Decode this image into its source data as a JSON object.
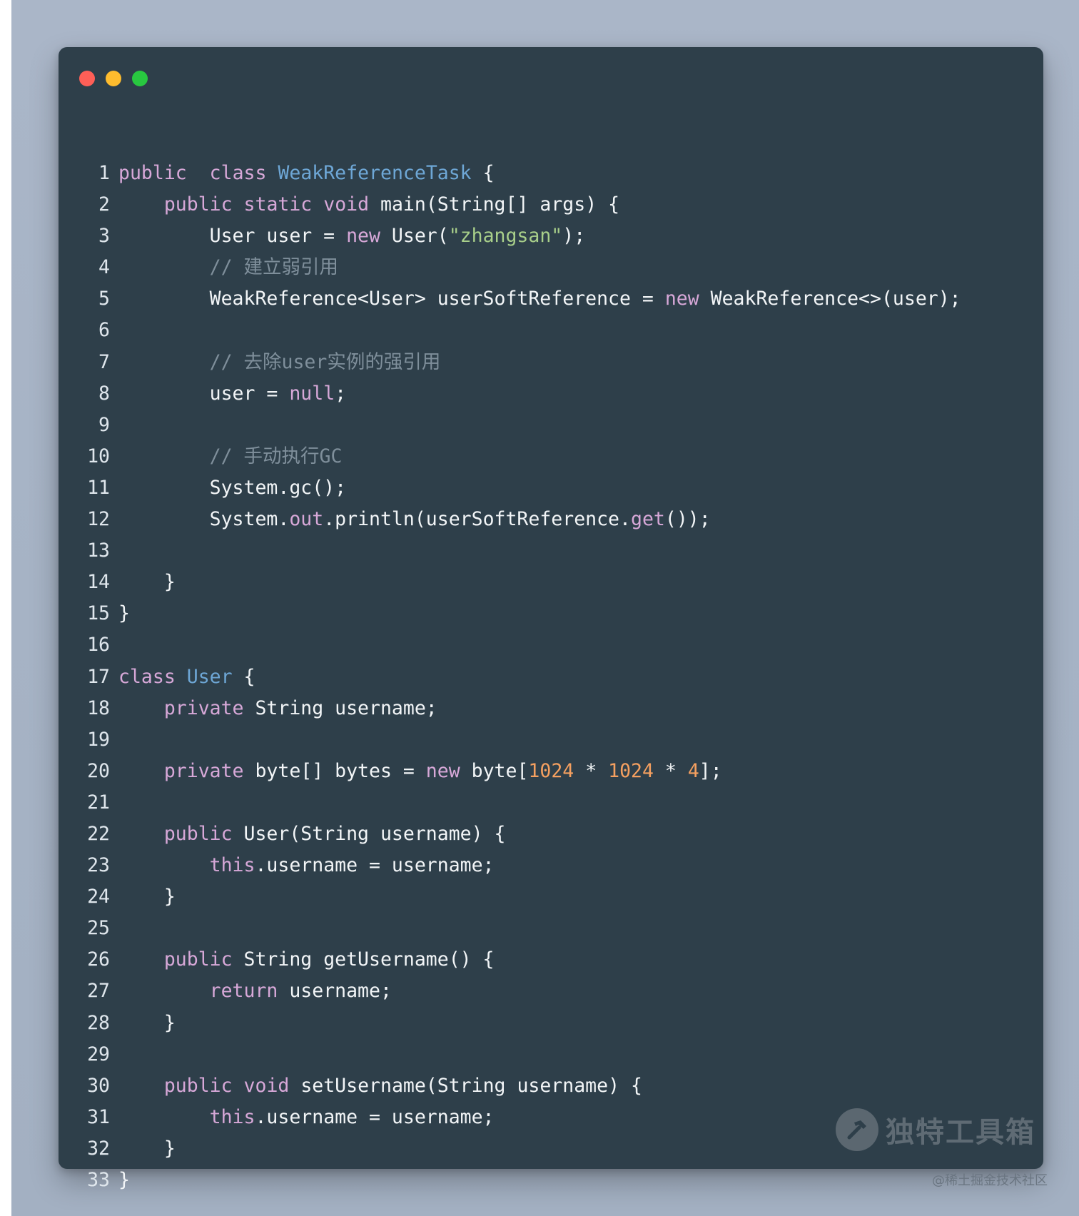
{
  "window_controls": {
    "close": "close",
    "minimize": "minimize",
    "maximize": "maximize"
  },
  "code_lines": [
    {
      "n": "1",
      "tokens": [
        [
          "kw",
          "public"
        ],
        [
          "",
          "  "
        ],
        [
          "kw",
          "class"
        ],
        [
          "",
          " "
        ],
        [
          "cls",
          "WeakReferenceTask"
        ],
        [
          "",
          " {"
        ]
      ]
    },
    {
      "n": "2",
      "tokens": [
        [
          "",
          "    "
        ],
        [
          "kw",
          "public"
        ],
        [
          "",
          " "
        ],
        [
          "kw",
          "static"
        ],
        [
          "",
          " "
        ],
        [
          "kw",
          "void"
        ],
        [
          "",
          " main(String[] args) {"
        ]
      ]
    },
    {
      "n": "3",
      "tokens": [
        [
          "",
          "        User user = "
        ],
        [
          "kw",
          "new"
        ],
        [
          "",
          " User("
        ],
        [
          "str",
          "\"zhangsan\""
        ],
        [
          "",
          ");"
        ]
      ]
    },
    {
      "n": "4",
      "tokens": [
        [
          "",
          "        "
        ],
        [
          "cmt",
          "// 建立弱引用"
        ]
      ]
    },
    {
      "n": "5",
      "tokens": [
        [
          "",
          "        WeakReference<User> userSoftReference = "
        ],
        [
          "kw",
          "new"
        ],
        [
          "",
          " WeakReference<>(user);"
        ]
      ]
    },
    {
      "n": "6",
      "tokens": []
    },
    {
      "n": "7",
      "tokens": [
        [
          "",
          "        "
        ],
        [
          "cmt",
          "// 去除user实例的强引用"
        ]
      ]
    },
    {
      "n": "8",
      "tokens": [
        [
          "",
          "        user = "
        ],
        [
          "kw",
          "null"
        ],
        [
          "",
          ";"
        ]
      ]
    },
    {
      "n": "9",
      "tokens": []
    },
    {
      "n": "10",
      "tokens": [
        [
          "",
          "        "
        ],
        [
          "cmt",
          "// 手动执行GC"
        ]
      ]
    },
    {
      "n": "11",
      "tokens": [
        [
          "",
          "        System.gc();"
        ]
      ]
    },
    {
      "n": "12",
      "tokens": [
        [
          "",
          "        System."
        ],
        [
          "kw",
          "out"
        ],
        [
          "",
          ".println(userSoftReference."
        ],
        [
          "kw",
          "get"
        ],
        [
          "",
          "());"
        ]
      ]
    },
    {
      "n": "13",
      "tokens": []
    },
    {
      "n": "14",
      "tokens": [
        [
          "",
          "    }"
        ]
      ]
    },
    {
      "n": "15",
      "tokens": [
        [
          "",
          "}"
        ]
      ]
    },
    {
      "n": "16",
      "tokens": []
    },
    {
      "n": "17",
      "tokens": [
        [
          "kw",
          "class"
        ],
        [
          "",
          " "
        ],
        [
          "cls",
          "User"
        ],
        [
          "",
          " {"
        ]
      ]
    },
    {
      "n": "18",
      "tokens": [
        [
          "",
          "    "
        ],
        [
          "kw",
          "private"
        ],
        [
          "",
          " String username;"
        ]
      ]
    },
    {
      "n": "19",
      "tokens": []
    },
    {
      "n": "20",
      "tokens": [
        [
          "",
          "    "
        ],
        [
          "kw",
          "private"
        ],
        [
          "",
          " byte[] bytes = "
        ],
        [
          "kw",
          "new"
        ],
        [
          "",
          " byte["
        ],
        [
          "num",
          "1024"
        ],
        [
          "",
          " * "
        ],
        [
          "num",
          "1024"
        ],
        [
          "",
          " * "
        ],
        [
          "num",
          "4"
        ],
        [
          "",
          "];"
        ]
      ]
    },
    {
      "n": "21",
      "tokens": []
    },
    {
      "n": "22",
      "tokens": [
        [
          "",
          "    "
        ],
        [
          "kw",
          "public"
        ],
        [
          "",
          " User(String username) {"
        ]
      ]
    },
    {
      "n": "23",
      "tokens": [
        [
          "",
          "        "
        ],
        [
          "kw",
          "this"
        ],
        [
          "",
          ".username = username;"
        ]
      ]
    },
    {
      "n": "24",
      "tokens": [
        [
          "",
          "    }"
        ]
      ]
    },
    {
      "n": "25",
      "tokens": []
    },
    {
      "n": "26",
      "tokens": [
        [
          "",
          "    "
        ],
        [
          "kw",
          "public"
        ],
        [
          "",
          " String getUsername() {"
        ]
      ]
    },
    {
      "n": "27",
      "tokens": [
        [
          "",
          "        "
        ],
        [
          "kw",
          "return"
        ],
        [
          "",
          " username;"
        ]
      ]
    },
    {
      "n": "28",
      "tokens": [
        [
          "",
          "    }"
        ]
      ]
    },
    {
      "n": "29",
      "tokens": []
    },
    {
      "n": "30",
      "tokens": [
        [
          "",
          "    "
        ],
        [
          "kw",
          "public"
        ],
        [
          "",
          " "
        ],
        [
          "kw",
          "void"
        ],
        [
          "",
          " setUsername(String username) {"
        ]
      ]
    },
    {
      "n": "31",
      "tokens": [
        [
          "",
          "        "
        ],
        [
          "kw",
          "this"
        ],
        [
          "",
          ".username = username;"
        ]
      ]
    },
    {
      "n": "32",
      "tokens": [
        [
          "",
          "    }"
        ]
      ]
    },
    {
      "n": "33",
      "tokens": [
        [
          "",
          "}"
        ]
      ]
    }
  ],
  "watermark": {
    "text": "独特工具箱",
    "icon": "hammer-icon"
  },
  "credit": "@稀土掘金技术社区",
  "colors": {
    "background": "#a6b3c5",
    "window": "#2e3f4a",
    "keyword": "#d7a8d8",
    "class_name": "#6ea7d6",
    "string": "#a8cf8a",
    "number": "#f5a060",
    "comment": "#7f8f9b",
    "close_dot": "#fe5f57",
    "minimize_dot": "#febc2e",
    "maximize_dot": "#28c840"
  }
}
